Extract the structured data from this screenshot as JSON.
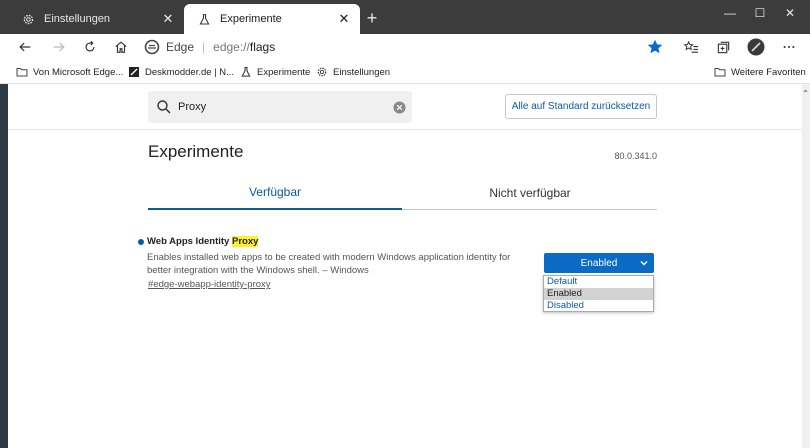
{
  "tabs": [
    {
      "title": "Einstellungen",
      "icon": "gear-icon",
      "active": false
    },
    {
      "title": "Experimente",
      "icon": "flask-icon",
      "active": true
    }
  ],
  "window": {
    "minimize": "—",
    "maximize": "☐",
    "close": "✕"
  },
  "address": {
    "site_name": "Edge",
    "url_prefix": "edge://",
    "url_page": "flags"
  },
  "favorites": [
    {
      "label": "Von Microsoft Edge...",
      "icon": "folder-icon"
    },
    {
      "label": "Deskmodder.de | N...",
      "icon": "deskmodder-icon"
    },
    {
      "label": "Experimente",
      "icon": "flask-icon"
    },
    {
      "label": "Einstellungen",
      "icon": "gear-icon"
    }
  ],
  "favorites_other": "Weitere Favoriten",
  "search": {
    "value": "Proxy"
  },
  "reset_button": "Alle auf Standard zurücksetzen",
  "page_title": "Experimente",
  "version": "80.0.341.0",
  "flag_tabs": {
    "available": "Verfügbar",
    "unavailable": "Nicht verfügbar"
  },
  "experiment": {
    "name_prefix": "Web Apps Identity ",
    "name_highlight": "Proxy",
    "description": "Enables installed web apps to be created with modern Windows application identity for better integration with the Windows shell. – Windows",
    "link": "#edge-webapp-identity-proxy",
    "selected": "Enabled",
    "options": [
      "Default",
      "Enabled",
      "Disabled"
    ]
  },
  "colors": {
    "accent": "#0a6bc4",
    "highlight": "#ffef2a",
    "titlebar": "#3c3c3c"
  }
}
